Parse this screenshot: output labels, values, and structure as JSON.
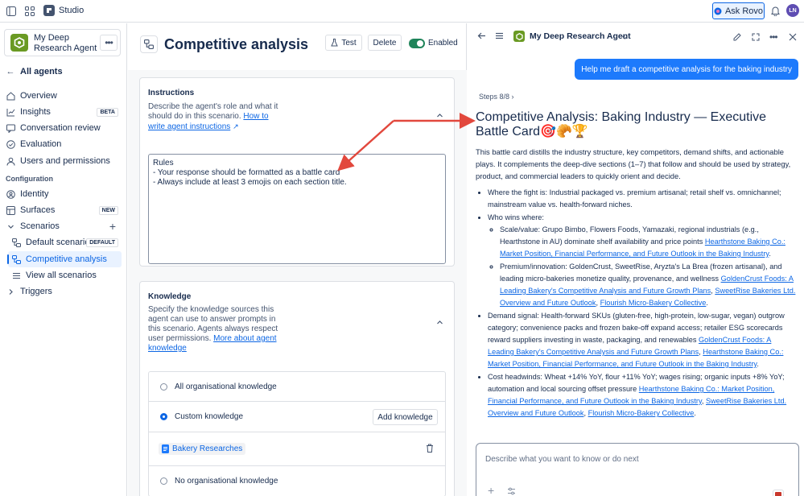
{
  "topbar": {
    "app_name": "Studio",
    "ask_rovo": "Ask Rovo",
    "avatar_initials": "LN"
  },
  "sidebar": {
    "agent_name": "My Deep Research Agent",
    "all_agents": "All agents",
    "items": [
      {
        "label": "Overview"
      },
      {
        "label": "Insights",
        "badge": "BETA"
      },
      {
        "label": "Conversation review"
      },
      {
        "label": "Evaluation"
      },
      {
        "label": "Users and permissions"
      }
    ],
    "configuration_label": "Configuration",
    "config_items": [
      {
        "label": "Identity"
      },
      {
        "label": "Surfaces",
        "badge": "NEW"
      },
      {
        "label": "Scenarios"
      }
    ],
    "scenarios": [
      {
        "label": "Default scenario",
        "badge": "DEFAULT"
      },
      {
        "label": "Competitive analysis"
      },
      {
        "label": "View all scenarios"
      }
    ],
    "triggers": "Triggers"
  },
  "main": {
    "title": "Competitive analysis",
    "test_label": "Test",
    "delete_label": "Delete",
    "enabled_label": "Enabled",
    "instructions": {
      "heading": "Instructions",
      "desc": "Describe the agent's role and what it should do in this scenario.",
      "link": "How to write agent instructions",
      "text": "Rules\n- Your response should be formatted as a battle card\n- Always include at least 3 emojis on each section title."
    },
    "knowledge": {
      "heading": "Knowledge",
      "desc": "Specify the knowledge sources this agent can use to answer prompts in this scenario. Agents always respect user permissions.",
      "link": "More about agent knowledge",
      "options": [
        "All organisational knowledge",
        "Custom knowledge",
        "No organisational knowledge"
      ],
      "add_label": "Add knowledge",
      "source": "Bakery Researches"
    }
  },
  "chat": {
    "agent_name": "My Deep Research Agent",
    "user_message": "Help me draft a competitive analysis for the baking industry",
    "steps": "Steps 8/8",
    "title": "Competitive Analysis: Baking Industry — Executive Battle Card",
    "title_emojis": "🎯🥐🏆",
    "intro": "This battle card distills the industry structure, key competitors, demand shifts, and actionable plays. It complements the deep-dive sections (1–7) that follow and should be used by strategy, product, and commercial leaders to quickly orient and decide.",
    "b1": "Where the fight is: Industrial packaged vs. premium artisanal; retail shelf vs. omnichannel; mainstream value vs. health-forward niches.",
    "b2": "Who wins where:",
    "b2a": "Scale/value: Grupo Bimbo, Flowers Foods, Yamazaki, regional industrials (e.g., Hearthstone in AU) dominate shelf availability and price points ",
    "link_hearth": "Hearthstone Baking Co.: Market Position, Financial Performance, and Future Outlook in the Baking Industry",
    "b2b": "Premium/innovation: GoldenCrust, SweetRise, Aryzta's La Brea (frozen artisanal), and leading micro-bakeries monetize quality, provenance, and wellness ",
    "link_golden": "GoldenCrust Foods: A Leading Bakery's Competitive Analysis and Future Growth Plans",
    "link_sweet": "SweetRise Bakeries Ltd. Overview and Future Outlook",
    "link_flourish": "Flourish Micro-Bakery Collective",
    "b3": "Demand signal: Health-forward SKUs (gluten-free, high-protein, low-sugar, vegan) outgrow category; convenience packs and frozen bake-off expand access; retailer ESG scorecards reward suppliers investing in waste, packaging, and renewables ",
    "b4": "Cost headwinds: Wheat +14% YoY, flour +11% YoY; wages rising; organic inputs +8% YoY; automation and local sourcing offset pressure ",
    "composer_placeholder": "Describe what you want to know or do next"
  },
  "colors": {
    "accent": "#0c66e4",
    "enabled": "#1f845a",
    "arrow": "#e2483d",
    "agent_logo": "#6a9a23"
  }
}
